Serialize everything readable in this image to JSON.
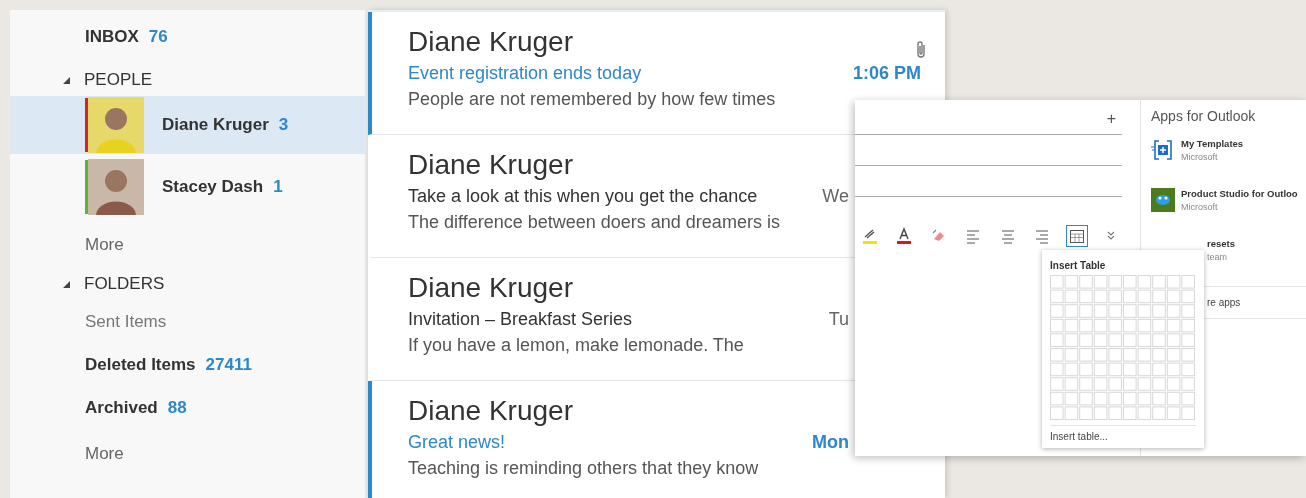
{
  "sidebar": {
    "inbox": {
      "label": "INBOX",
      "count": "76"
    },
    "sections": [
      {
        "title": "PEOPLE",
        "expanded": true,
        "kind": "people",
        "items": [
          {
            "name": "Diane Kruger",
            "count": "3",
            "selected": true,
            "color": "#d0262b"
          },
          {
            "name": "Stacey Dash",
            "count": "1",
            "selected": false,
            "color": "#5cb531"
          }
        ],
        "more": "More"
      },
      {
        "title": "FOLDERS",
        "expanded": true,
        "kind": "folders",
        "items": [
          {
            "name": "Sent Items",
            "unread": false,
            "selected": false
          },
          {
            "name": "Deleted Items",
            "count": "27411",
            "unread": true,
            "selected": false
          },
          {
            "name": "Archived",
            "count": "88",
            "unread": true,
            "selected": false
          }
        ],
        "more": "More"
      }
    ]
  },
  "messages": [
    {
      "sender": "Diane Kruger",
      "subject": "Event registration ends today",
      "preview": "People are not remembered by how few times",
      "date": "1:06 PM",
      "unread": true,
      "attachment": true
    },
    {
      "sender": "Diane Kruger",
      "subject": "Take a look at this when you get the chance",
      "preview": "The difference between doers and dreamers is",
      "date": "We",
      "unread": false,
      "attachment": false
    },
    {
      "sender": "Diane Kruger",
      "subject": "Invitation – Breakfast Series",
      "preview": "If you have a lemon, make lemonade. The",
      "date": "Tu",
      "unread": false,
      "attachment": false
    },
    {
      "sender": "Diane Kruger",
      "subject": "Great news!",
      "preview": "Teaching is reminding others that they know",
      "date": "Mon",
      "unread": true,
      "attachment": false
    }
  ],
  "compose": {
    "fields": [
      {
        "kind": "recipient",
        "add_label": "+"
      },
      {
        "kind": "line"
      },
      {
        "kind": "line"
      }
    ],
    "toolbar": [
      {
        "kind": "highlight",
        "selected": false
      },
      {
        "kind": "font-color",
        "selected": false
      },
      {
        "kind": "eraser",
        "selected": false
      },
      {
        "kind": "align-left",
        "selected": false
      },
      {
        "kind": "align-center",
        "selected": false
      },
      {
        "kind": "align-right",
        "selected": false
      },
      {
        "kind": "table",
        "selected": true
      },
      {
        "kind": "more",
        "selected": false
      }
    ],
    "insert_table": {
      "title": "Insert Table",
      "link": "Insert table..."
    },
    "apps": {
      "title": "Apps for Outlook",
      "items": [
        {
          "kind": "templates",
          "name": "My Templates",
          "publisher": "Microsoft",
          "partly_covered": false
        },
        {
          "kind": "studio",
          "name": "Product Studio for Outloo",
          "publisher": "Microsoft",
          "partly_covered": false
        },
        {
          "kind": "presets",
          "name": "resets",
          "publisher": "team",
          "partly_covered": true
        },
        {
          "kind": "link",
          "name": "re apps",
          "partly_covered": true
        }
      ]
    }
  }
}
